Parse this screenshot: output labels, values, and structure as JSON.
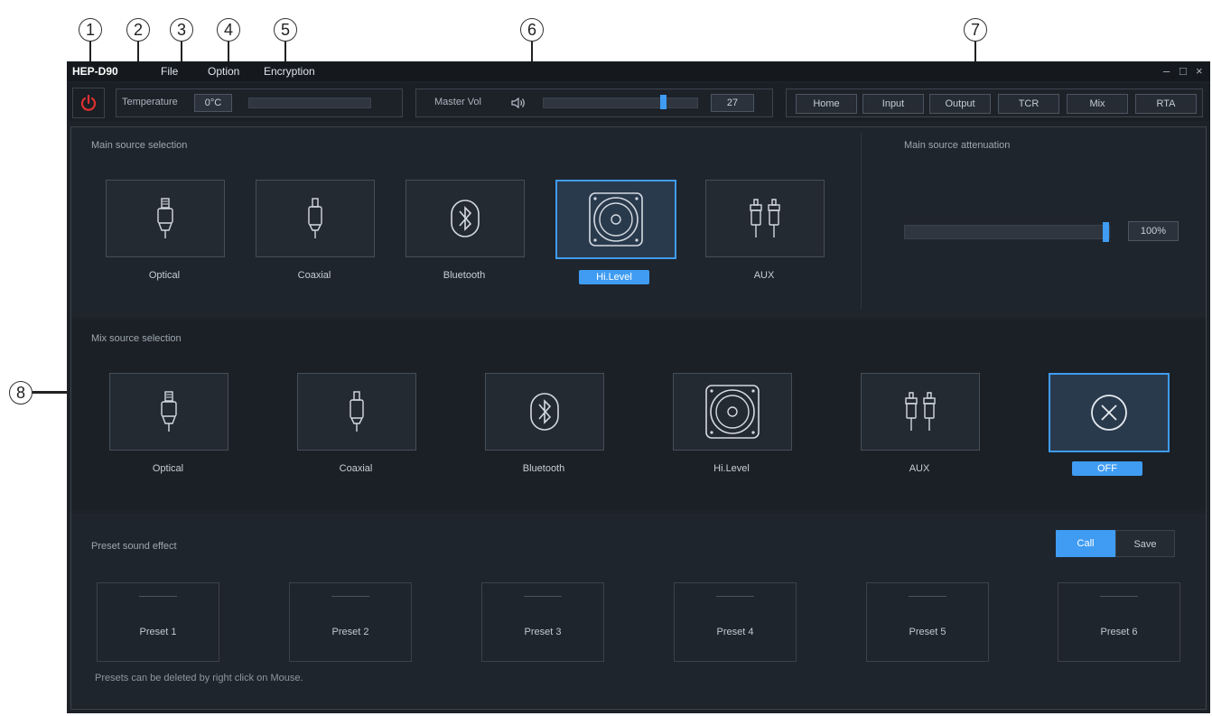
{
  "callouts": [
    "1",
    "2",
    "3",
    "4",
    "5",
    "6",
    "7",
    "8"
  ],
  "app": {
    "title": "HEP-D90"
  },
  "menu": {
    "file": "File",
    "option": "Option",
    "encryption": "Encryption"
  },
  "window_controls": {
    "minimize": "–",
    "maximize": "□",
    "close": "×"
  },
  "toolbar": {
    "temperature_label": "Temperature",
    "temperature_value": "0°C",
    "master_vol_label": "Master Vol",
    "master_vol_value": "27",
    "master_vol_level": 0.79
  },
  "nav": {
    "tabs": [
      "Home",
      "Input",
      "Output",
      "TCR",
      "Mix",
      "RTA"
    ],
    "active": "Home"
  },
  "main_source": {
    "title": "Main source selection",
    "items": [
      "Optical",
      "Coaxial",
      "Bluetooth",
      "Hi.Level",
      "AUX"
    ],
    "selected": "Hi.Level"
  },
  "attenuation": {
    "title": "Main source attenuation",
    "value": "100%",
    "level": 1.0
  },
  "mix_source": {
    "title": "Mix  source selection",
    "items": [
      "Optical",
      "Coaxial",
      "Bluetooth",
      "Hi.Level",
      "AUX",
      "OFF"
    ],
    "selected": "OFF"
  },
  "presets": {
    "title": "Preset sound effect",
    "call_label": "Call",
    "save_label": "Save",
    "items": [
      "Preset 1",
      "Preset 2",
      "Preset 3",
      "Preset 4",
      "Preset 5",
      "Preset 6"
    ],
    "note": "Presets can be deleted by right click on Mouse."
  },
  "colors": {
    "accent": "#3f9cf2",
    "power": "#e0312f",
    "window_bg": "#1d2229"
  }
}
